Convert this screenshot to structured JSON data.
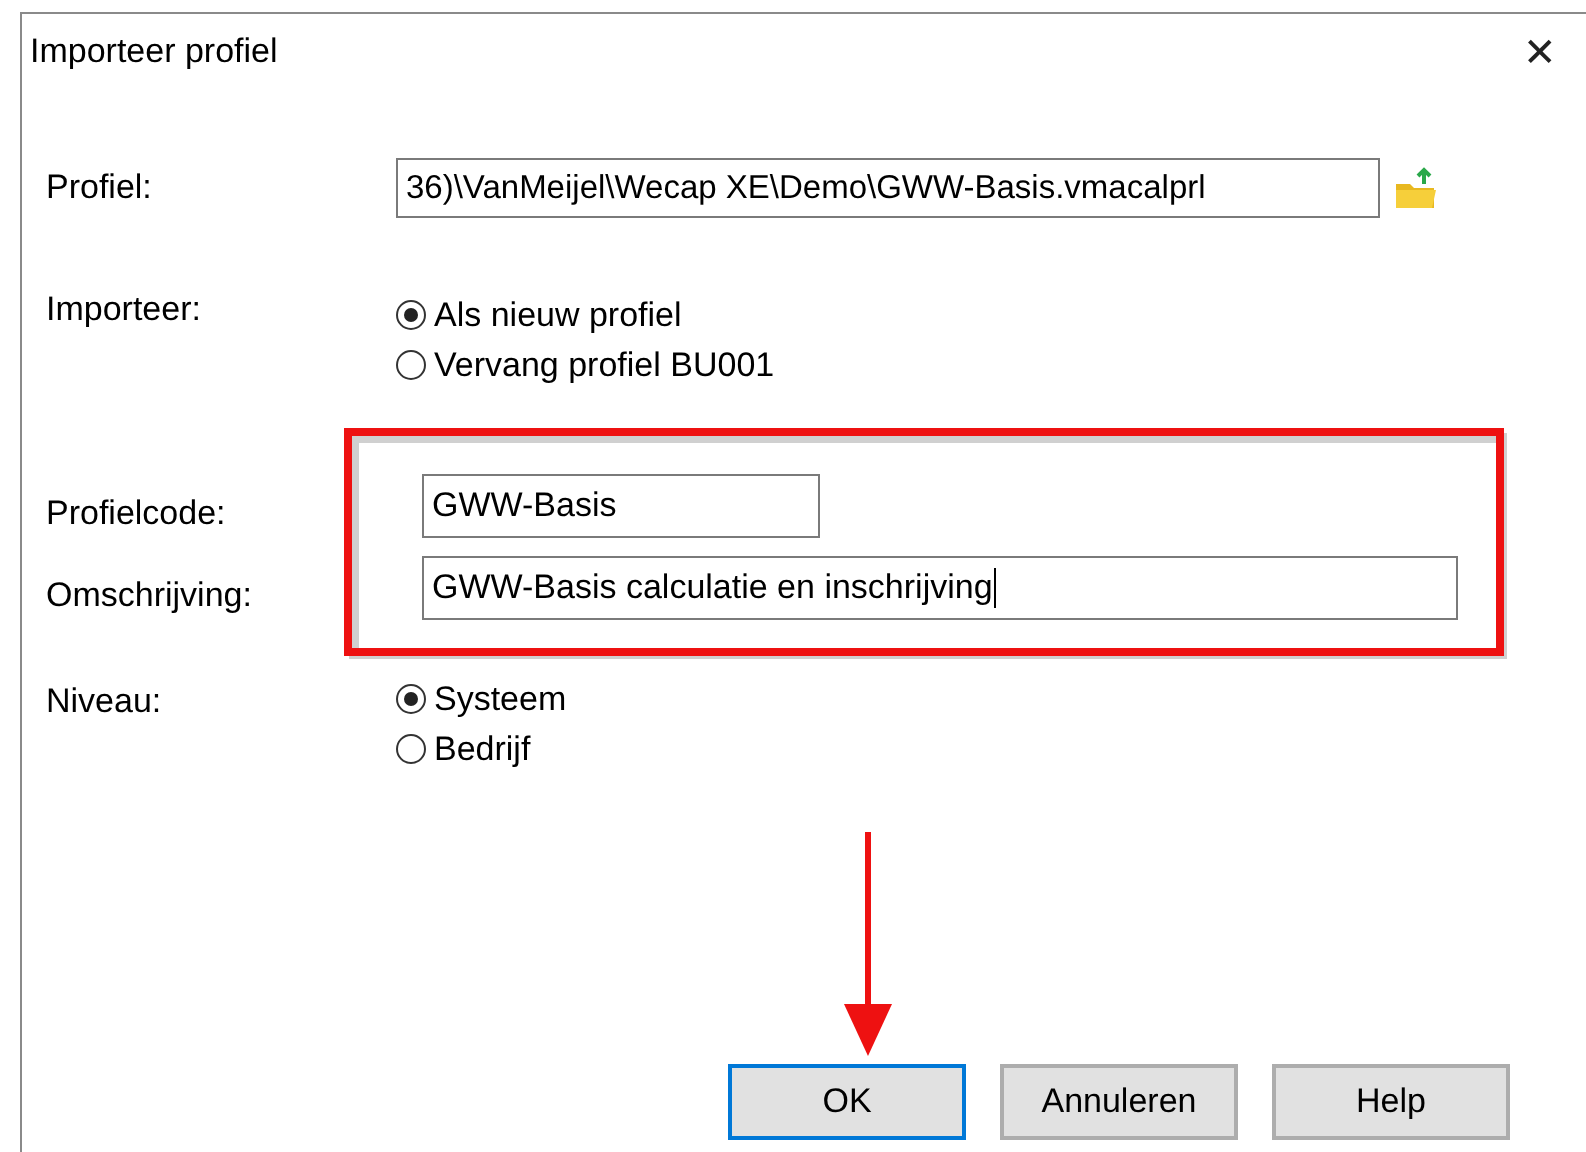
{
  "window": {
    "title": "Importeer profiel",
    "close": "✕"
  },
  "profile": {
    "label": "Profiel:",
    "value": "36)\\VanMeijel\\Wecap XE\\Demo\\GWW-Basis.vmacalprl"
  },
  "import": {
    "label": "Importeer:",
    "options": [
      {
        "label": "Als nieuw profiel",
        "selected": true
      },
      {
        "label": "Vervang profiel BU001",
        "selected": false
      }
    ]
  },
  "fields": [
    {
      "label": "Profielcode:",
      "value": "GWW-Basis",
      "kind": "short",
      "focused": false
    },
    {
      "label": "Omschrijving:",
      "value": "GWW-Basis calculatie en inschrijving",
      "kind": "long",
      "focused": true
    }
  ],
  "level": {
    "label": "Niveau:",
    "options": [
      {
        "label": "Systeem",
        "selected": true
      },
      {
        "label": "Bedrijf",
        "selected": false
      }
    ]
  },
  "buttons": [
    {
      "label": "OK",
      "default": true
    },
    {
      "label": "Annuleren",
      "default": false
    },
    {
      "label": "Help",
      "default": false
    }
  ],
  "annotations": [
    {
      "kind": "frame"
    },
    {
      "kind": "arrow"
    }
  ]
}
